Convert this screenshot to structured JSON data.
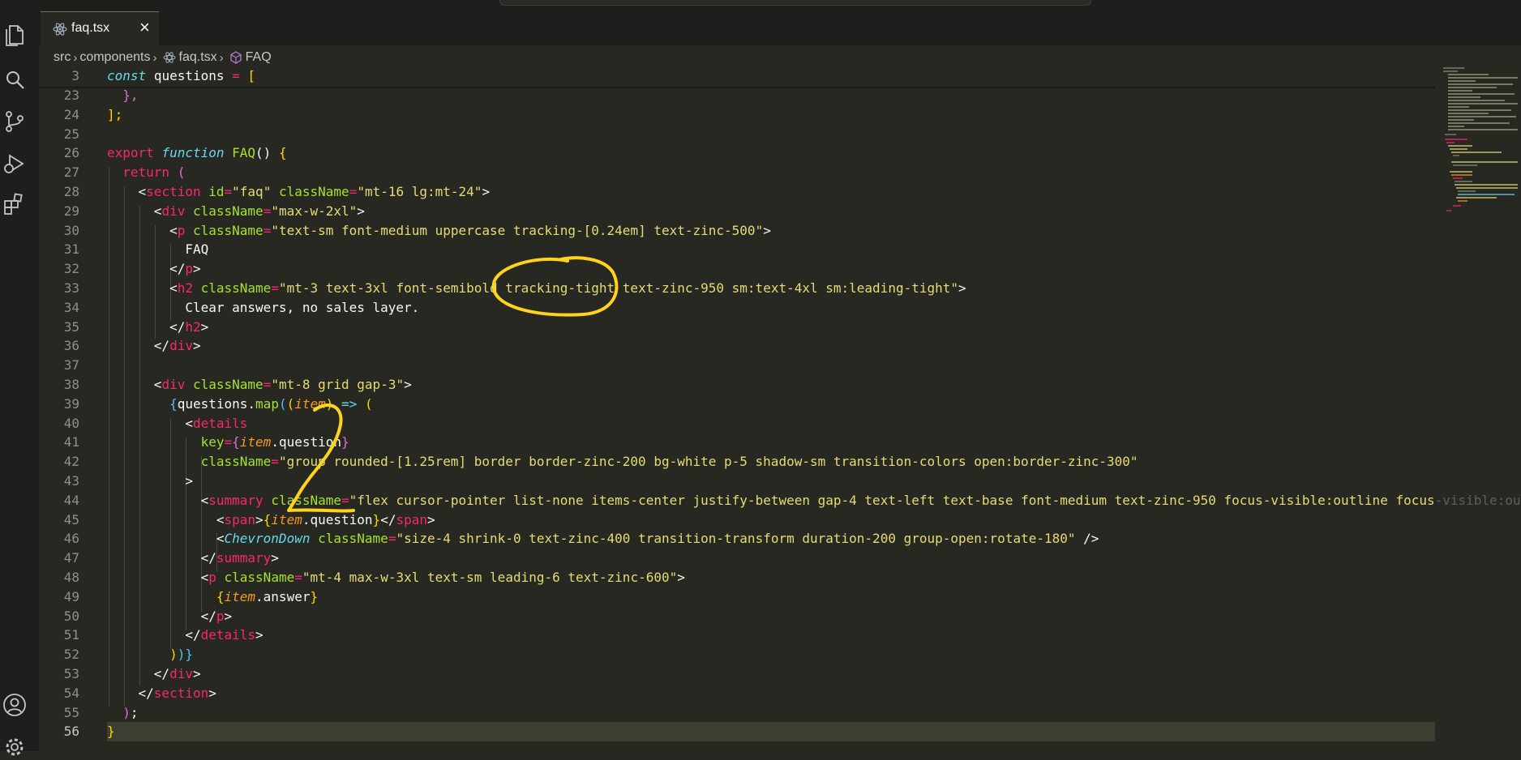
{
  "tab": {
    "filename": "faq.tsx",
    "close": "×"
  },
  "breadcrumb": {
    "src": "src",
    "components": "components",
    "file": "faq.tsx",
    "symbol": "FAQ"
  },
  "more": "…",
  "gutter": [
    "3",
    "23",
    "24",
    "25",
    "26",
    "27",
    "28",
    "29",
    "30",
    "31",
    "32",
    "33",
    "34",
    "35",
    "36",
    "37",
    "38",
    "39",
    "40",
    "41",
    "42",
    "43",
    "44",
    "45",
    "46",
    "47",
    "48",
    "49",
    "50",
    "51",
    "52",
    "53",
    "54",
    "55",
    "56"
  ],
  "code": {
    "l3": [
      "const",
      " ",
      "questions",
      " = ",
      "["
    ],
    "l23": [
      "  },"
    ],
    "l24": [
      "];"
    ],
    "l26": [
      "export",
      " ",
      "function",
      " ",
      "FAQ",
      "() ",
      "{"
    ],
    "l27": [
      "  ",
      "return",
      " ",
      "("
    ],
    "l28": [
      "    <",
      "section",
      " ",
      "id",
      "=",
      "\"faq\"",
      " ",
      "className",
      "=",
      "\"mt-16 lg:mt-24\"",
      ">"
    ],
    "l29": [
      "      <",
      "div",
      " ",
      "className",
      "=",
      "\"max-w-2xl\"",
      ">"
    ],
    "l30": [
      "        <",
      "p",
      " ",
      "className",
      "=",
      "\"text-sm font-medium uppercase tracking-[0.24em] text-zinc-500\"",
      ">"
    ],
    "l31": [
      "          FAQ"
    ],
    "l32": [
      "        </",
      "p",
      ">"
    ],
    "l33": [
      "        <",
      "h2",
      " ",
      "className",
      "=",
      "\"mt-3 text-3xl font-semibold tracking-tight text-zinc-950 sm:text-4xl sm:leading-tight\"",
      ">"
    ],
    "l34": [
      "          Clear answers, no sales layer."
    ],
    "l35": [
      "        </",
      "h2",
      ">"
    ],
    "l36": [
      "      </",
      "div",
      ">"
    ],
    "l38": [
      "      <",
      "div",
      " ",
      "className",
      "=",
      "\"mt-8 grid gap-3\"",
      ">"
    ],
    "l39": [
      "        ",
      "{",
      "questions",
      ".",
      "map",
      "(",
      "(",
      "item",
      ")",
      " => ",
      "("
    ],
    "l40": [
      "          <",
      "details"
    ],
    "l41": [
      "            ",
      "key",
      "=",
      "{",
      "item",
      ".question",
      "}"
    ],
    "l42": [
      "            ",
      "className",
      "=",
      "\"group rounded-[1.25rem] border border-zinc-200 bg-white p-5 shadow-sm transition-colors open:border-zinc-300\""
    ],
    "l43": [
      "          >"
    ],
    "l44": [
      "            <",
      "summary",
      " ",
      "className",
      "=",
      "\"flex cursor-pointer list-none items-center justify-between gap-4 text-left text-base font-medium text-zinc-950 focus-visible:outline focus",
      "-visible:ou"
    ],
    "l45": [
      "              <",
      "span",
      ">",
      "{",
      "item",
      ".question",
      "}",
      "</",
      "span",
      ">"
    ],
    "l46": [
      "              <",
      "ChevronDown",
      " ",
      "className",
      "=",
      "\"size-4 shrink-0 text-zinc-400 transition-transform duration-200 group-open:rotate-180\"",
      " />"
    ],
    "l47": [
      "            </",
      "summary",
      ">"
    ],
    "l48": [
      "            <",
      "p",
      " ",
      "className",
      "=",
      "\"mt-4 max-w-3xl text-sm leading-6 text-zinc-600\"",
      ">"
    ],
    "l49": [
      "              ",
      "{",
      "item",
      ".answer",
      "}"
    ],
    "l50": [
      "            </",
      "p",
      ">"
    ],
    "l51": [
      "          </",
      "details",
      ">"
    ],
    "l52": [
      "        ",
      ")",
      ")",
      "}"
    ],
    "l53": [
      "      </",
      "div",
      ">"
    ],
    "l54": [
      "    </",
      "section",
      ">"
    ],
    "l55": [
      "  ",
      ")",
      ";"
    ],
    "l56": [
      "}"
    ]
  },
  "colors": {
    "keyword": "#f92672",
    "string": "#e6db74",
    "function": "#a6e22e",
    "background": "#272822",
    "annotation": "#ffd21f"
  },
  "icons": [
    "explorer-icon",
    "search-icon",
    "source-control-icon",
    "run-debug-icon",
    "extensions-icon",
    "account-icon",
    "settings-icon",
    "react-file-icon",
    "symbol-icon",
    "split-editor-icon"
  ],
  "annotation": {
    "number": "2"
  }
}
